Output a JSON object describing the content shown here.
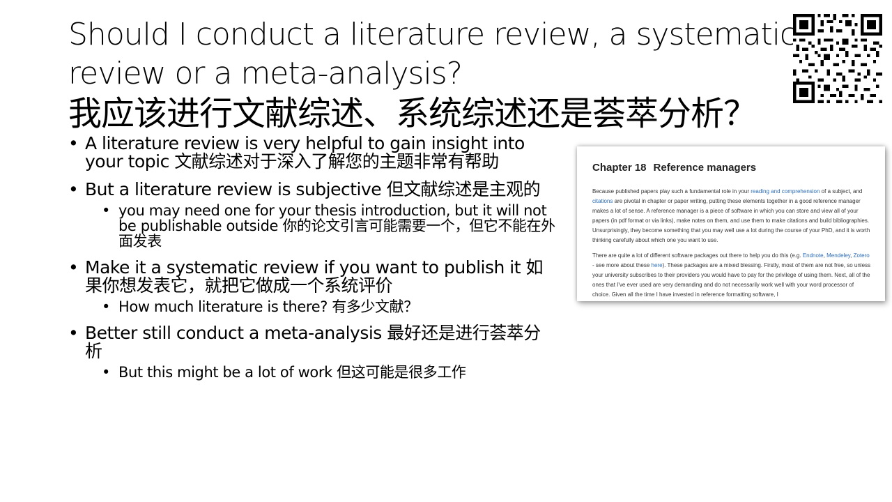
{
  "title": {
    "line1": "Should I conduct a literature review, a systematic",
    "line2": "review or a meta-analysis?",
    "line3": "我应该进行文献综述、系统综述还是荟萃分析？"
  },
  "bullets": [
    {
      "text": "A literature review is very helpful to gain insight into your topic   文献综述对于深入了解您的主题非常有帮助"
    },
    {
      "text": "But a literature review is subjective    但文献综述是主观的"
    },
    {
      "text": "you may need one for your thesis introduction, but it will not be publishable outside   你的论文引言可能需要一个，但它不能在外面发表"
    },
    {
      "text": "Make it a systematic review if you want to publish it 如果你想发表它，就把它做成一个系统评价"
    },
    {
      "text": "How much literature is there?    有多少文献？"
    },
    {
      "text": "Better still conduct  a meta-analysis    最好还是进行荟萃分析"
    },
    {
      "text": "But this might be a lot of work    但这可能是很多工作"
    }
  ],
  "book_page": {
    "chapter_number": "Chapter 18",
    "chapter_title": "Reference managers",
    "p1": {
      "a": "Because published papers play such a fundamental role in your ",
      "link1": "reading and comprehension",
      "b": " of a subject, and ",
      "link2": "citations",
      "c": " are pivotal in chapter or paper writing, putting these elements together in a good reference manager makes a lot of sense. A reference manager is a piece of software in which you can store and view all of your papers (in pdf format or via links), make notes on them, and use them to make citations and build bibliographies. Unsurprisingly, they become something that you may well use a lot during the course of your PhD, and it is worth thinking carefully about which one you want to use."
    },
    "p2": {
      "a": "There are quite a lot of different software packages out there to help you do this (e.g. ",
      "link1": "Endnote",
      "sep1": ", ",
      "link2": "Mendeley",
      "sep2": ", ",
      "link3": "Zotero",
      "b": " - see more about these ",
      "link4": "here",
      "c": "). These packages are a mixed blessing. Firstly, most of them are not free, so unless your university subscribes to their providers you would have to pay for the privilege of using them. Next, all of the ones that I've ever used are very demanding and do not necessarily work well with your word processor of choice. Given all the time I have invested in reference formatting software, I"
    }
  },
  "icons": {
    "qr": "qr-code-icon"
  }
}
